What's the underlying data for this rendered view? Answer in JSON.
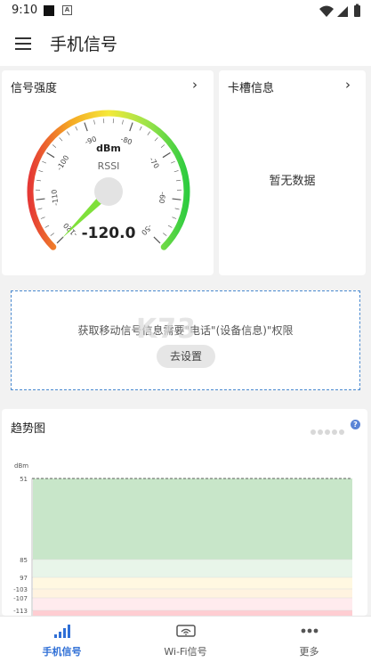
{
  "status_bar": {
    "time": "9:10",
    "notification_letter": "A"
  },
  "app_bar": {
    "title": "手机信号"
  },
  "signal_card": {
    "title": "信号强度",
    "chevron": "›",
    "gauge": {
      "unit": "dBm",
      "measure": "RSSI",
      "value_text": "-120.0",
      "value": -120.0,
      "min": -120,
      "max": -50,
      "tick_labels": [
        "-120",
        "-110",
        "-100",
        "-90",
        "-80",
        "-70",
        "-60",
        "-50"
      ],
      "arc_colors": [
        "#e53935",
        "#f5a623",
        "#f5e93a",
        "#9be34a",
        "#2ecc40"
      ],
      "needle_color": "#7fe03a"
    }
  },
  "sim_card": {
    "title": "卡槽信息",
    "chevron": "›",
    "empty_text": "暂无数据"
  },
  "permission": {
    "text": "获取移动信号信息需要\"电话\"(设备信息)\"权限",
    "button": "去设置",
    "watermark": "K73"
  },
  "trend_card": {
    "title": "趋势图",
    "help_icon": "?",
    "chart_data": {
      "type": "area",
      "ylabel": "dBm",
      "y_ticks": [
        "51",
        "85",
        "97",
        "-103",
        "-107",
        "-113"
      ],
      "bands": [
        {
          "label": "51",
          "color": "#c8e6c9"
        },
        {
          "label": "85",
          "color": "#e8f5e9"
        },
        {
          "label": "97",
          "color": "#fff8e1"
        },
        {
          "label": "-103",
          "color": "#fff3e0"
        },
        {
          "label": "-107",
          "color": "#ffebee"
        },
        {
          "label": "-113",
          "color": "#ffcdd2"
        }
      ]
    }
  },
  "bottom_nav": {
    "items": [
      {
        "label": "手机信号",
        "icon": "signal-bars-icon",
        "active": true
      },
      {
        "label": "Wi-Fi信号",
        "icon": "wifi-icon",
        "active": false
      },
      {
        "label": "更多",
        "icon": "more-dots-icon",
        "active": false
      }
    ]
  },
  "colors": {
    "accent": "#2f6fd6",
    "dashed_border": "#4a8ad0",
    "help": "#5a84d6"
  }
}
